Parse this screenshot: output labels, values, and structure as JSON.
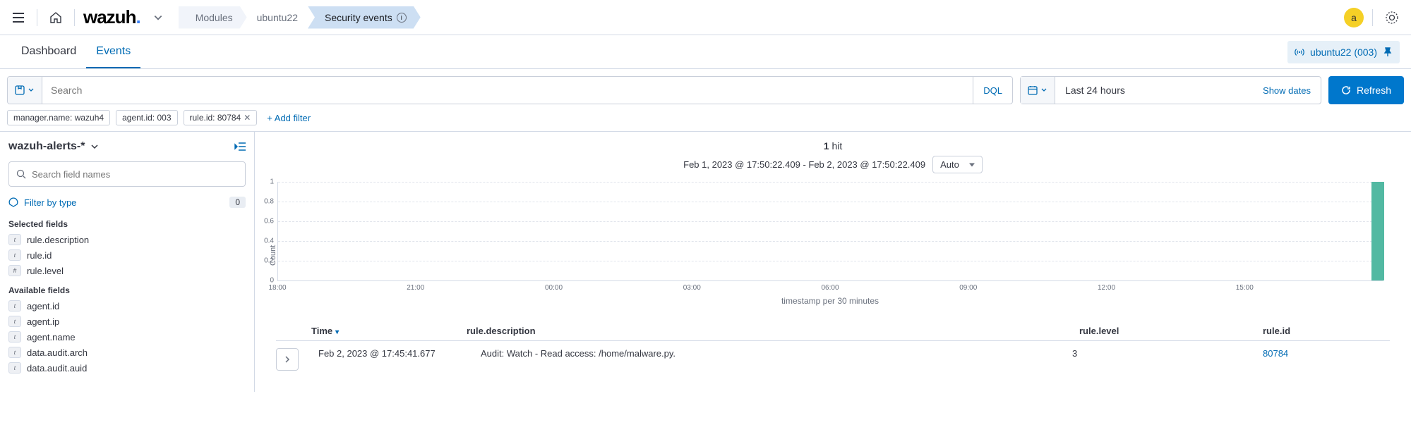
{
  "topbar": {
    "logo_text": "wazuh",
    "breadcrumbs": [
      "Modules",
      "ubuntu22",
      "Security events"
    ],
    "avatar_letter": "a"
  },
  "tabs": {
    "items": [
      "Dashboard",
      "Events"
    ],
    "active": "Events",
    "agent_badge": "ubuntu22 (003)"
  },
  "search": {
    "placeholder": "Search",
    "dql_label": "DQL",
    "date_range": "Last 24 hours",
    "show_dates": "Show dates",
    "refresh": "Refresh"
  },
  "filters": {
    "pills": [
      "manager.name: wazuh4",
      "agent.id: 003",
      "rule.id: 80784"
    ],
    "add_label": "+ Add filter"
  },
  "sidebar": {
    "index_pattern": "wazuh-alerts-*",
    "field_search_placeholder": "Search field names",
    "filter_type_label": "Filter by type",
    "filter_type_count": "0",
    "selected_header": "Selected fields",
    "selected_fields": [
      {
        "type": "t",
        "name": "rule.description"
      },
      {
        "type": "t",
        "name": "rule.id"
      },
      {
        "type": "#",
        "name": "rule.level"
      }
    ],
    "available_header": "Available fields",
    "available_fields": [
      {
        "type": "t",
        "name": "agent.id"
      },
      {
        "type": "t",
        "name": "agent.ip"
      },
      {
        "type": "t",
        "name": "agent.name"
      },
      {
        "type": "t",
        "name": "data.audit.arch"
      },
      {
        "type": "t",
        "name": "data.audit.auid"
      }
    ]
  },
  "results": {
    "hit_count": "1",
    "hit_suffix": "hit",
    "time_range_text": "Feb 1, 2023 @ 17:50:22.409 - Feb 2, 2023 @ 17:50:22.409",
    "interval_select": "Auto",
    "xaxis_label": "timestamp per 30 minutes",
    "yaxis_label": "Count",
    "columns": {
      "time": "Time",
      "desc": "rule.description",
      "level": "rule.level",
      "ruleid": "rule.id"
    },
    "rows": [
      {
        "time": "Feb 2, 2023 @ 17:45:41.677",
        "desc": "Audit: Watch - Read access: /home/malware.py.",
        "level": "3",
        "ruleid": "80784"
      }
    ]
  },
  "chart_data": {
    "type": "bar",
    "ylabel": "Count",
    "ylim": [
      0,
      1
    ],
    "y_ticks": [
      0,
      0.2,
      0.4,
      0.6,
      0.8,
      1
    ],
    "x_ticks": [
      "18:00",
      "21:00",
      "00:00",
      "03:00",
      "06:00",
      "09:00",
      "12:00",
      "15:00"
    ],
    "xlabel": "timestamp per 30 minutes",
    "categories_range_hours": [
      18,
      42
    ],
    "bars": [
      {
        "bucket_hour": 41.75,
        "value": 1
      }
    ],
    "color": "#52b9a2"
  }
}
